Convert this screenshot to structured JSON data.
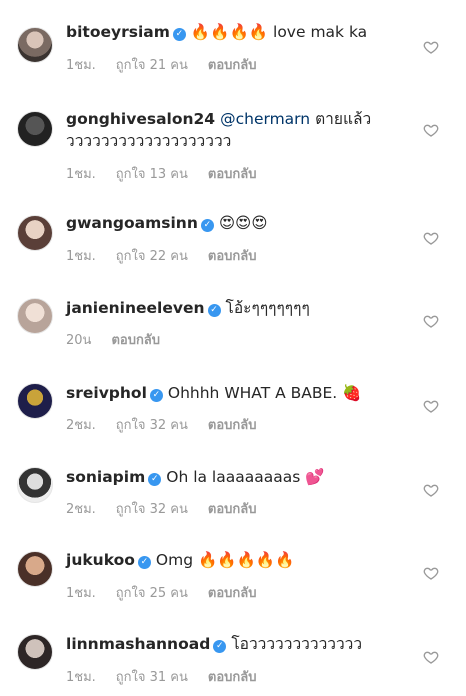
{
  "comments": [
    {
      "username": "bitoeyrsiam",
      "verified": true,
      "text": "🔥🔥🔥🔥 love mak ka",
      "time": "1ชม.",
      "likes": "ถูกใจ 21 คน",
      "reply": "ตอบกลับ"
    },
    {
      "username": "gonghivesalon24",
      "verified": false,
      "mention": "@chermarn",
      "text": "ตายแล้ว",
      "text2": "ววววววววววววววววววว",
      "time": "1ชม.",
      "likes": "ถูกใจ 13 คน",
      "reply": "ตอบกลับ"
    },
    {
      "username": "gwangoamsinn",
      "verified": true,
      "text": "😍😍😍",
      "time": "1ชม.",
      "likes": "ถูกใจ 22 คน",
      "reply": "ตอบกลับ"
    },
    {
      "username": "janienineeleven",
      "verified": true,
      "text": "โอ้ะๆๆๆๆๆๆๆ",
      "time": "20น",
      "reply": "ตอบกลับ"
    },
    {
      "username": "sreivphol",
      "verified": true,
      "text": "Ohhhh WHAT A BABE. 🍓",
      "time": "2ชม.",
      "likes": "ถูกใจ 32 คน",
      "reply": "ตอบกลับ"
    },
    {
      "username": "soniapim",
      "verified": true,
      "text": "Oh la laaaaaaaas 💕",
      "time": "2ชม.",
      "likes": "ถูกใจ 32 คน",
      "reply": "ตอบกลับ"
    },
    {
      "username": "jukukoo",
      "verified": true,
      "text": "Omg 🔥🔥🔥🔥🔥",
      "time": "1ชม.",
      "likes": "ถูกใจ 25 คน",
      "reply": "ตอบกลับ"
    },
    {
      "username": "linnmashannoad",
      "verified": true,
      "text": "โอววววววววววววว",
      "time": "1ชม.",
      "likes": "ถูกใจ 31 คน",
      "reply": "ตอบกลับ"
    }
  ]
}
